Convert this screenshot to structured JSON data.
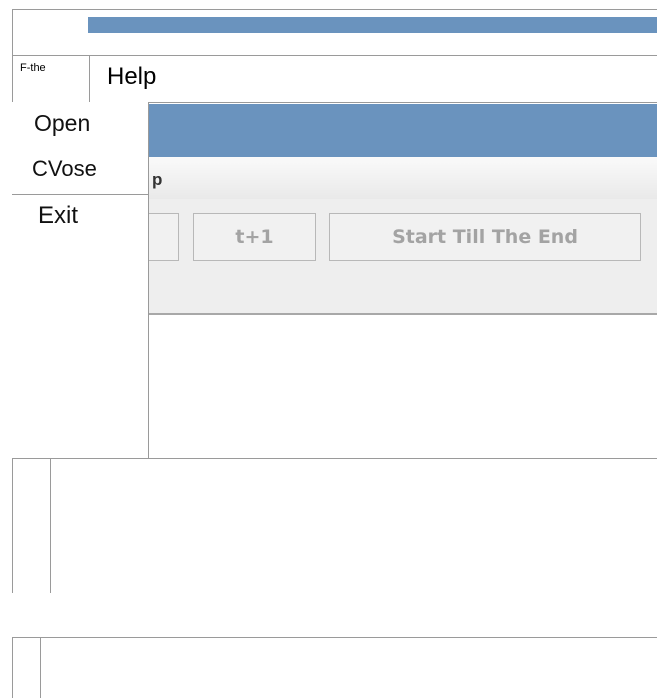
{
  "menubar": {
    "file_label": "F-the",
    "help_label": "Help"
  },
  "dropdown": {
    "items": [
      {
        "label": "Open"
      },
      {
        "label": "CVose"
      },
      {
        "label": "Exit"
      }
    ]
  },
  "inner_app": {
    "menubar_text": "p",
    "toolbar": {
      "partial_button_label": "",
      "step_button_label": "t+1",
      "run_button_label": "Start Till The End"
    }
  },
  "colors": {
    "titlebar": "#6a93be",
    "disabled_text": "#a3a3a3"
  }
}
